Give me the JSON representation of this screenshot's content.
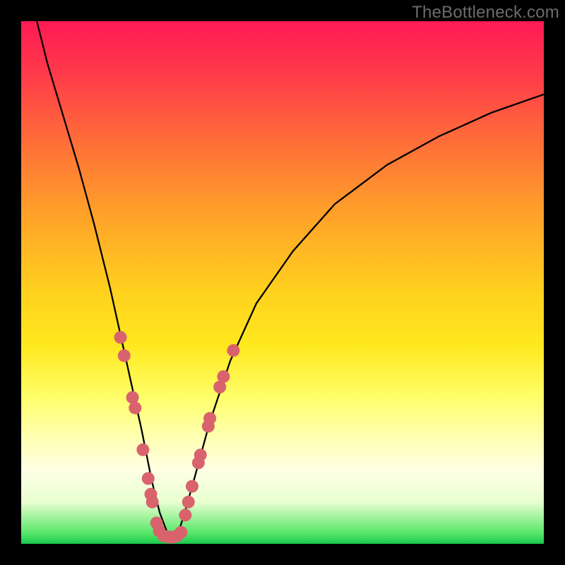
{
  "watermark": "TheBottleneck.com",
  "chart_data": {
    "type": "line",
    "title": "",
    "xlabel": "",
    "ylabel": "",
    "xlim": [
      0,
      100
    ],
    "ylim": [
      0,
      100
    ],
    "series": [
      {
        "name": "bottleneck-curve",
        "x": [
          3,
          5,
          8,
          11,
          14,
          17,
          19,
          21,
          23,
          25,
          26.5,
          28,
          29,
          30,
          31,
          33,
          36,
          40,
          45,
          52,
          60,
          70,
          80,
          90,
          100
        ],
        "y": [
          100,
          92,
          82,
          72,
          61,
          49,
          40,
          31,
          22,
          12,
          6,
          2,
          1.5,
          2,
          5,
          12,
          23,
          35,
          46,
          56,
          65,
          72.5,
          78,
          82.5,
          86
        ]
      },
      {
        "name": "dot-overlay-left",
        "x": [
          19.0,
          19.7,
          21.3,
          21.8,
          23.3,
          24.3,
          24.8,
          25.1,
          25.9,
          26.4
        ],
        "y": [
          39.5,
          36.0,
          28.0,
          26.0,
          18.0,
          12.5,
          9.5,
          8.0,
          4.0,
          2.5
        ]
      },
      {
        "name": "dot-overlay-bottom",
        "x": [
          27.3,
          28.2,
          29.0,
          29.8,
          30.6
        ],
        "y": [
          1.5,
          1.3,
          1.3,
          1.5,
          2.2
        ]
      },
      {
        "name": "dot-overlay-right",
        "x": [
          31.4,
          32.0,
          32.7,
          33.9,
          34.3,
          35.8,
          36.1,
          38.0,
          38.7,
          40.6
        ],
        "y": [
          5.5,
          8.0,
          11.0,
          15.5,
          17.0,
          22.5,
          24.0,
          30.0,
          32.0,
          37.0
        ]
      }
    ],
    "colors": {
      "curve": "#000000",
      "dots": "#d9636d",
      "gradient_top": "#ff1a55",
      "gradient_bottom": "#19c94e"
    }
  }
}
